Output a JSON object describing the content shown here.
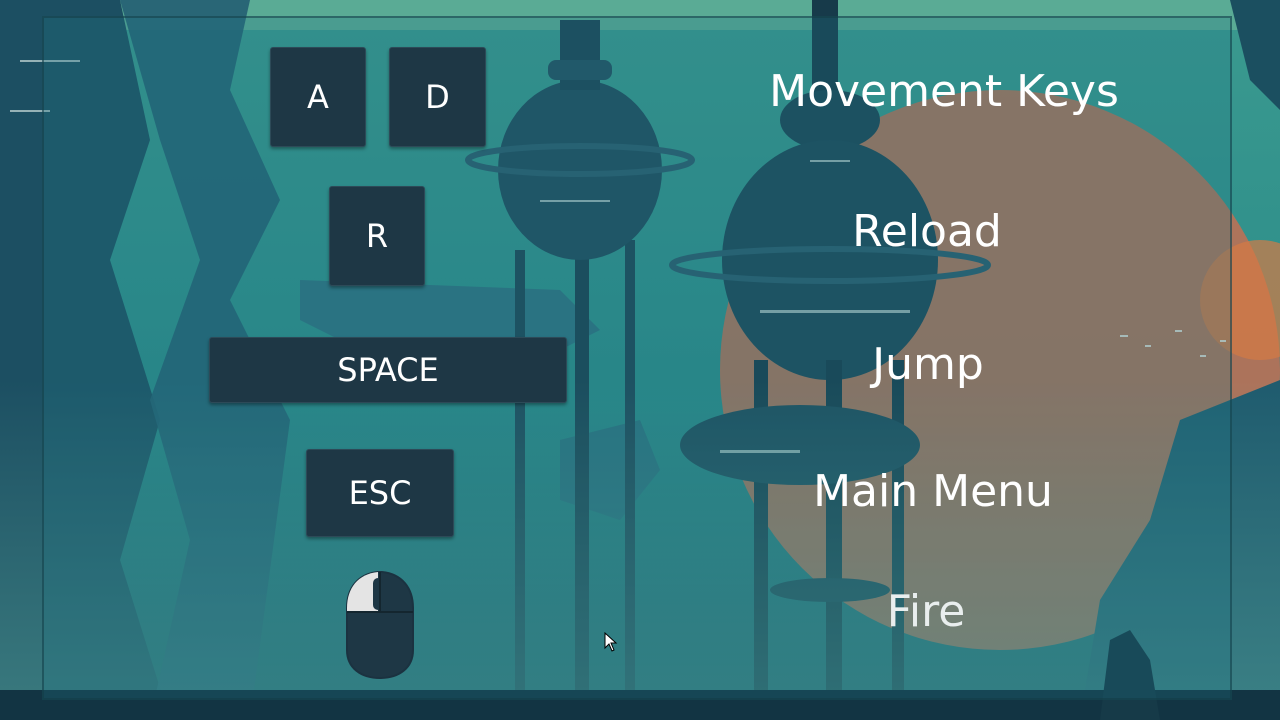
{
  "controls": {
    "keys": {
      "a": "A",
      "d": "D",
      "r": "R",
      "space": "SPACE",
      "esc": "ESC"
    },
    "actions": {
      "movement": "Movement Keys",
      "reload": "Reload",
      "jump": "Jump",
      "main_menu": "Main Menu",
      "fire": "Fire"
    },
    "fire_input_icon": "mouse-left-click-icon"
  },
  "colors": {
    "key_background": "#1e3745",
    "label_text": "#ffffff",
    "accent_sun": "#c8704f"
  }
}
